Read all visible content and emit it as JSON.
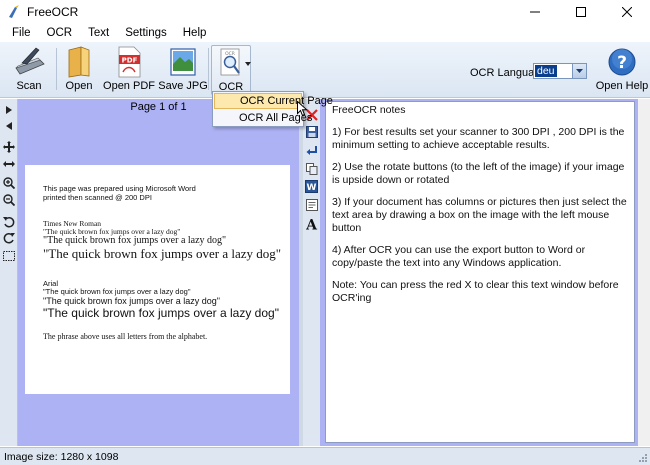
{
  "window": {
    "title": "FreeOCR"
  },
  "menu": [
    "File",
    "OCR",
    "Text",
    "Settings",
    "Help"
  ],
  "toolbar": {
    "scan": "Scan",
    "open": "Open",
    "open_pdf": "Open PDF",
    "save_jpg": "Save JPG",
    "ocr": "OCR",
    "ocr_language_label": "OCR Language:",
    "ocr_language_value": "deu",
    "open_help": "Open Help"
  },
  "ocr_dropdown": [
    "OCR Current Page",
    "OCR All Pages"
  ],
  "image_pane": {
    "page_label": "Page 1 of 1",
    "lines": [
      "This page was prepared using Microsoft Word",
      "printed then scanned @ 200 DPI",
      "Times New Roman",
      "\"The quick brown fox jumps over a lazy dog\"",
      "\"The quick brown fox jumps over a lazy dog\"",
      "\"The quick brown fox jumps over a lazy dog\"",
      "Arial",
      "\"The quick brown fox jumps over a lazy dog\"",
      "\"The quick brown fox  jumps over a lazy dog\"",
      "\"The quick brown fox jumps over a lazy dog\"",
      "The phrase above uses all letters from the alphabet."
    ]
  },
  "text_pane": {
    "paragraphs": [
      "FreeOCR notes",
      "1) For best results set your scanner to 300 DPI , 200 DPI is the minimum setting to achieve acceptable results.",
      "2) Use the rotate buttons (to the left of the image) if your image is upside down or rotated",
      "3) If your document has columns or pictures then just select the text area by drawing a box on the image with the left mouse button",
      "4) After OCR you can use the export button to Word or copy/paste the text into any Windows application.",
      "Note: You can press the red X to clear this text window before OCR'ing"
    ]
  },
  "status": {
    "image_size": "Image size:  1280 x 1098"
  },
  "colors": {
    "pane_background": "#adb2f5",
    "toolbar_background": "#dbe6f3",
    "dropdown_hover": "#fde9ad"
  }
}
